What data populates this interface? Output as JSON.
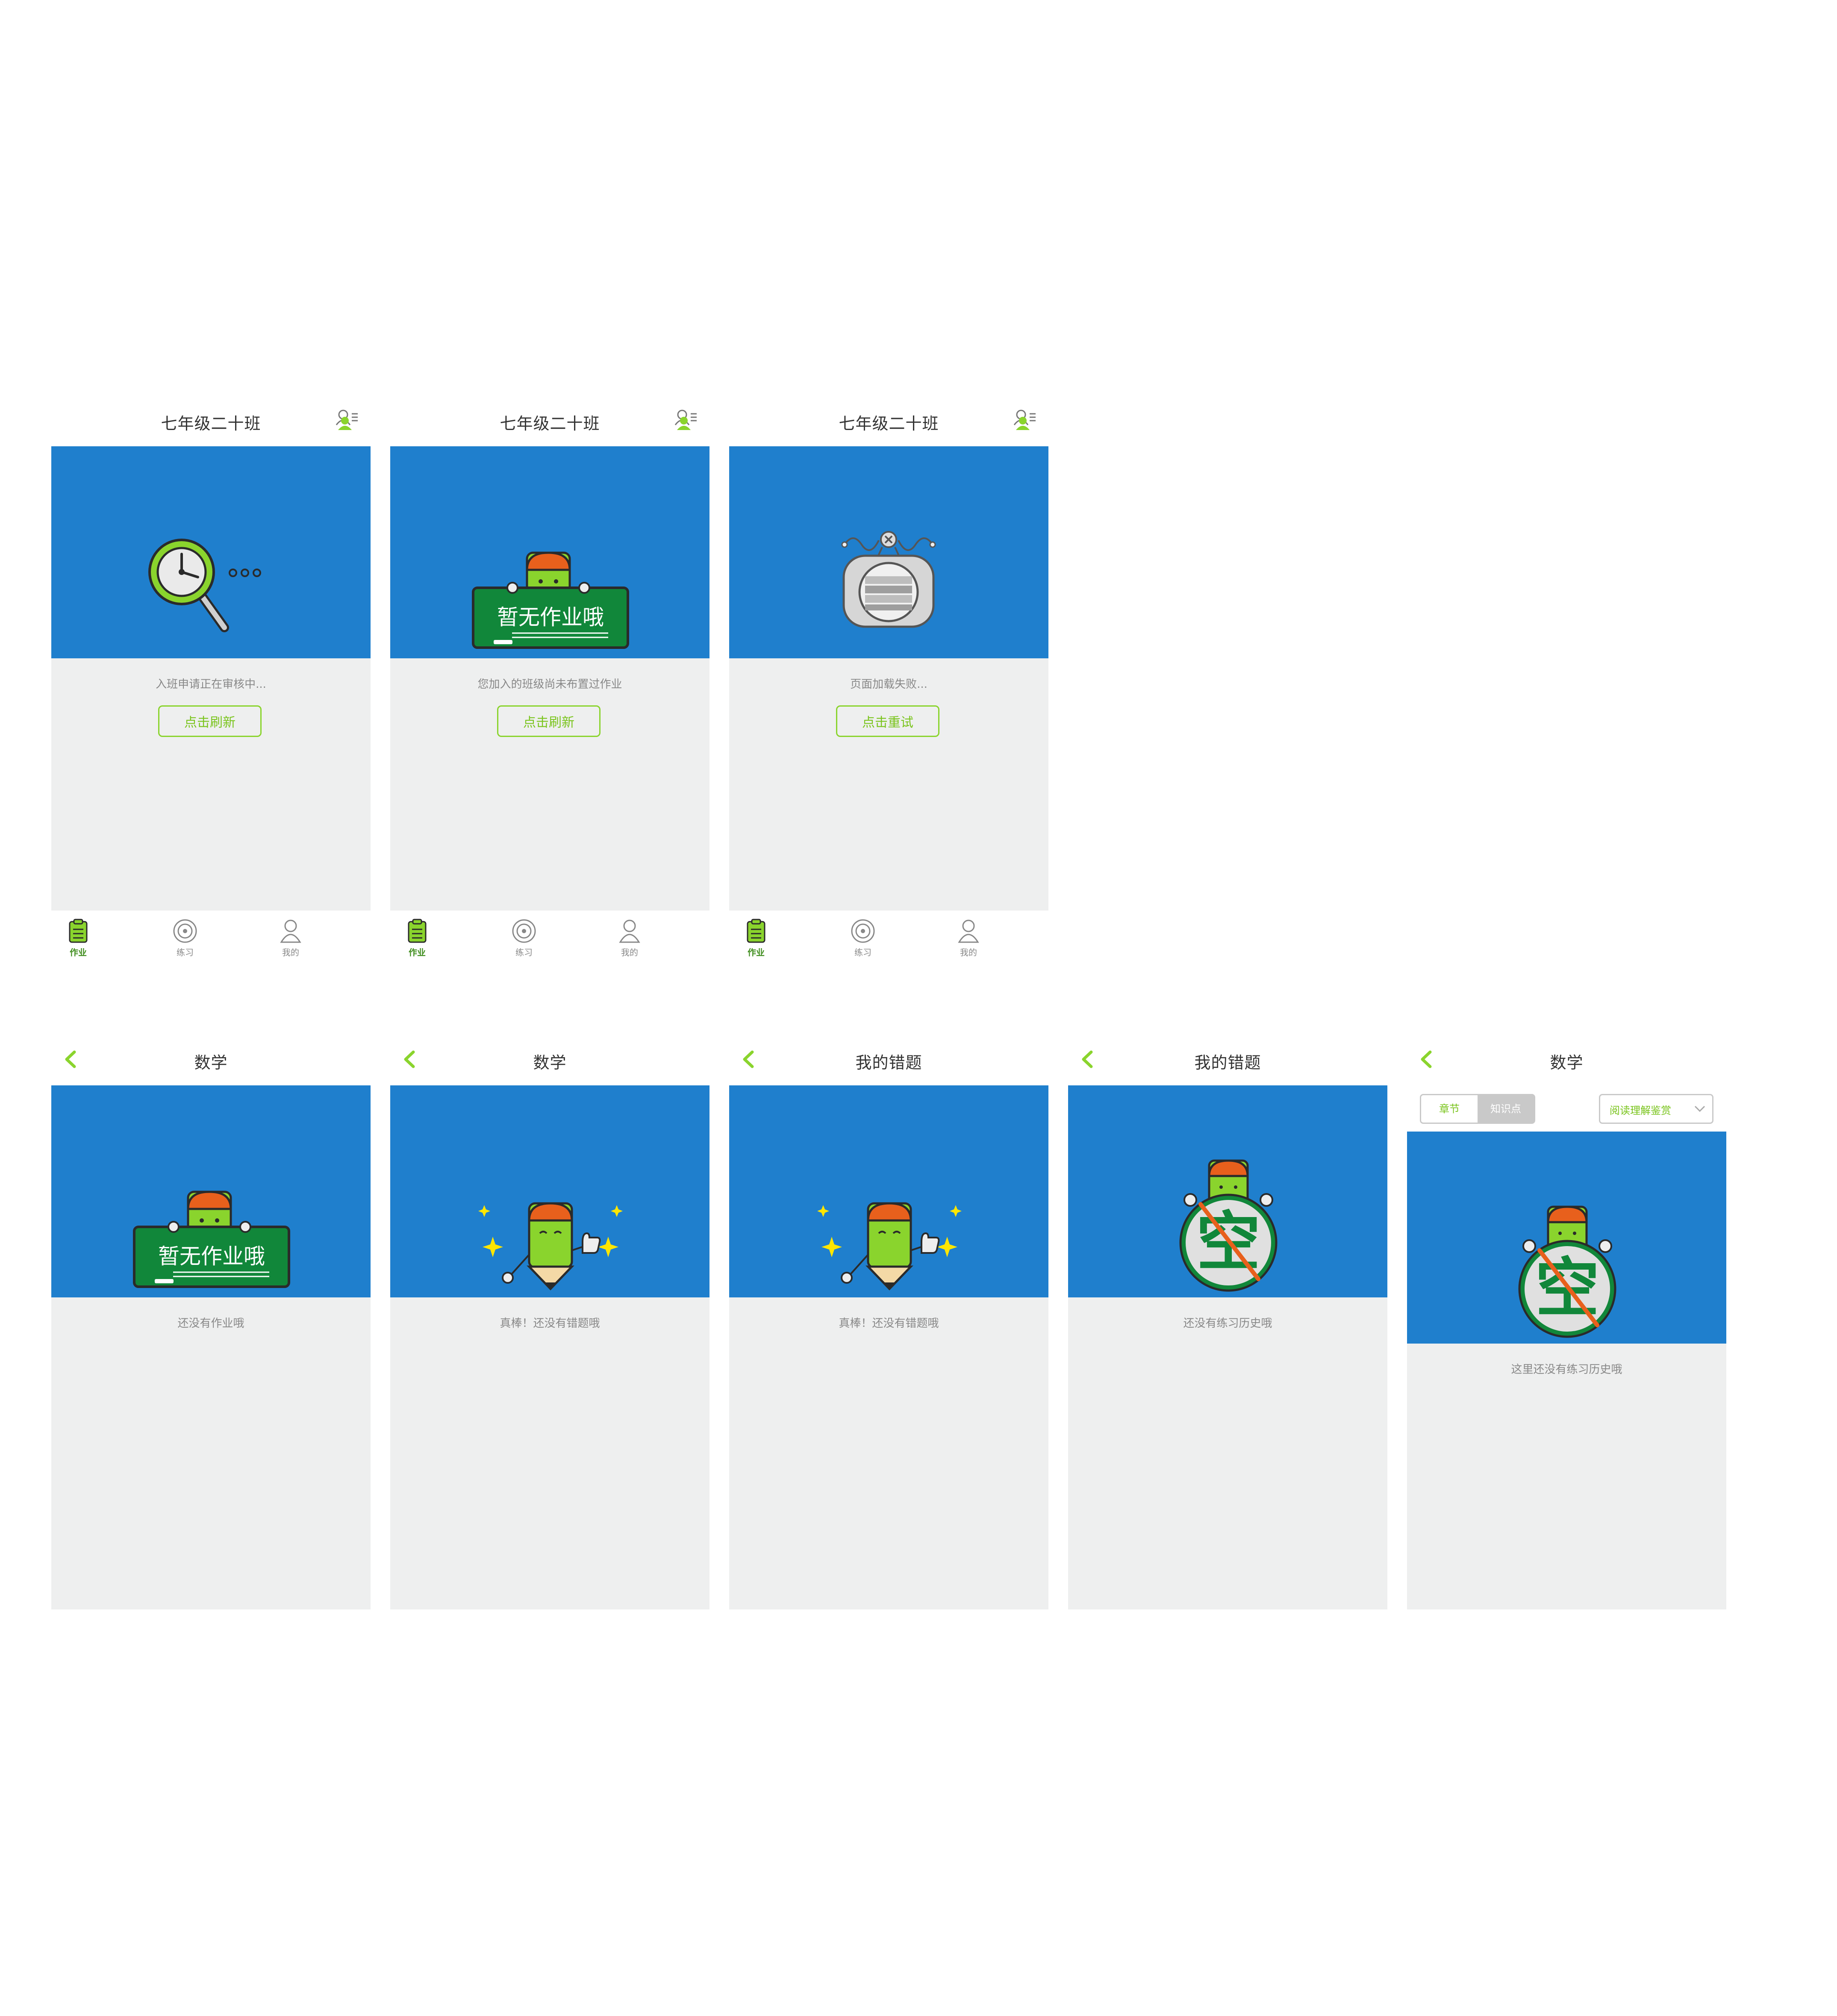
{
  "screens": {
    "s1": {
      "title": "七年级二十班",
      "message": "入班申请正在审核中...",
      "button": "点击刷新"
    },
    "s2": {
      "title": "七年级二十班",
      "message": "您加入的班级尚未布置过作业",
      "button": "点击刷新"
    },
    "s3": {
      "title": "七年级二十班",
      "message": "页面加载失败...",
      "button": "点击重试"
    },
    "s4": {
      "title": "数学",
      "message": "还没有作业哦"
    },
    "s5": {
      "title": "数学",
      "message": "真棒！还没有错题哦"
    },
    "s6": {
      "title": "我的错题",
      "message": "真棒！还没有错题哦"
    },
    "s7": {
      "title": "我的错题",
      "message": "还没有练习历史哦"
    },
    "s8": {
      "title": "数学",
      "message": "这里还没有练习历史哦",
      "segment": [
        "章节",
        "知识点"
      ],
      "dropdown": "阅读理解鉴赏"
    }
  },
  "tabs": [
    "作业",
    "练习",
    "我的"
  ],
  "board_text": "暂无作业哦",
  "empty_char": "空",
  "icons": {
    "back": "chevron-left-icon",
    "classmates": "classmates-icon",
    "homework": "clipboard-icon",
    "practice": "target-icon",
    "profile": "user-icon"
  },
  "colors": {
    "brand_green": "#8ad42d",
    "dark_green": "#3f8d1d",
    "hero_blue": "#1f7fcd",
    "content_gray": "#eeefef"
  }
}
